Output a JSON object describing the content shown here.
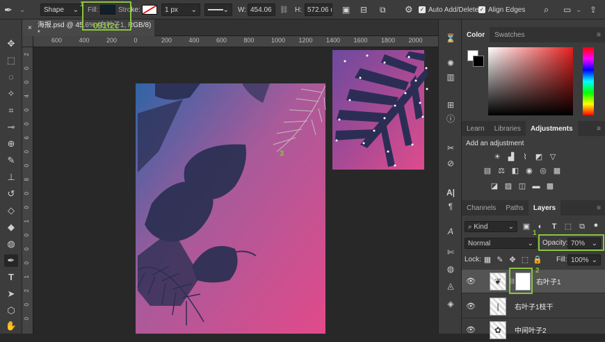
{
  "options_bar": {
    "mode": "Shape",
    "fill_label": "Fill:",
    "stroke_label": "Stroke:",
    "stroke_width": "1 px",
    "w_label": "W:",
    "w_value": "454.06",
    "h_label": "H:",
    "h_value": "572.06 r",
    "auto_add_delete": "Auto Add/Delete",
    "align_edges": "Align Edges",
    "fill_color": "#091f2c"
  },
  "annotations": {
    "fill_hex": "091f2c",
    "step1": "1",
    "step1b": "1",
    "step2": "2",
    "step3": "3",
    "accent": "#8cc63f"
  },
  "document": {
    "tab_title": "海报.psd @ 45.6% (右叶子1, RGB/8) *",
    "close": "×"
  },
  "rulers": {
    "top": [
      "600",
      "400",
      "200",
      "0",
      "200",
      "400",
      "600",
      "800",
      "1000",
      "1200",
      "1400",
      "1600",
      "1800",
      "2000"
    ],
    "left": [
      "2",
      "0",
      "0",
      "4",
      "0",
      "0",
      "6",
      "0",
      "0",
      "8",
      "0",
      "0",
      "1",
      "0",
      "0",
      "0",
      "1",
      "2",
      "0",
      "0"
    ]
  },
  "color_panel": {
    "tabs": [
      "Color",
      "Swatches"
    ],
    "active": "Color"
  },
  "adjust_panel": {
    "tabs": [
      "Learn",
      "Libraries",
      "Adjustments"
    ],
    "active": "Adjustments",
    "heading": "Add an adjustment"
  },
  "layers_panel": {
    "tabs": [
      "Channels",
      "Paths",
      "Layers"
    ],
    "active": "Layers",
    "filter_kind": "Kind",
    "blend_mode": "Normal",
    "opacity_label": "Opacity:",
    "opacity_value": "70%",
    "lock_label": "Lock:",
    "fill_label": "Fill:",
    "fill_value": "100%",
    "layers": [
      {
        "name": "右叶子1",
        "selected": true,
        "mask": true
      },
      {
        "name": "右叶子1枝干",
        "selected": false,
        "mask": false
      },
      {
        "name": "中间叶子2",
        "selected": false,
        "mask": false
      }
    ]
  }
}
